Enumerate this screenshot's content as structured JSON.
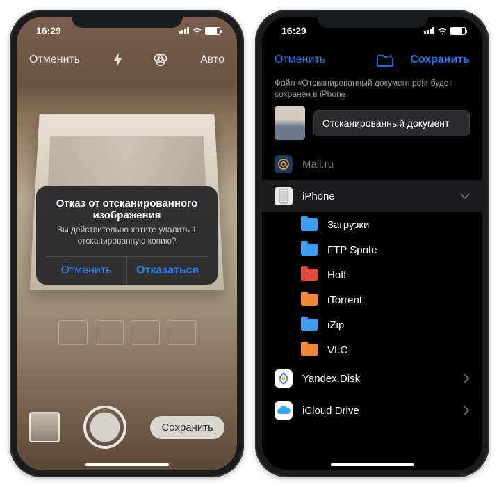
{
  "status": {
    "time": "16:29"
  },
  "phone1": {
    "topbar": {
      "cancel": "Отменить",
      "auto": "Авто"
    },
    "dialog": {
      "title": "Отказ от отсканированного изображения",
      "body": "Вы действительно хотите удалить 1 отсканированную копию?",
      "cancel": "Отменить",
      "discard": "Отказаться"
    },
    "save": "Сохранить"
  },
  "phone2": {
    "topbar": {
      "cancel": "Отменить",
      "save": "Сохранить"
    },
    "info": "Файл «Отсканированный документ.pdf» будет сохранен в iPhone.",
    "docname": "Отсканированный документ",
    "locations": {
      "mail": "Mail.ru",
      "iphone": "iPhone",
      "yandex": "Yandex.Disk",
      "icloud": "iCloud Drive"
    },
    "folders": [
      {
        "label": "Загрузки",
        "color": "f-blue"
      },
      {
        "label": "FTP Sprite",
        "color": "f-blue"
      },
      {
        "label": "Hoff",
        "color": "f-red"
      },
      {
        "label": "iTorrent",
        "color": "f-orange"
      },
      {
        "label": "iZip",
        "color": "f-blue"
      },
      {
        "label": "VLC",
        "color": "f-orange"
      }
    ]
  }
}
